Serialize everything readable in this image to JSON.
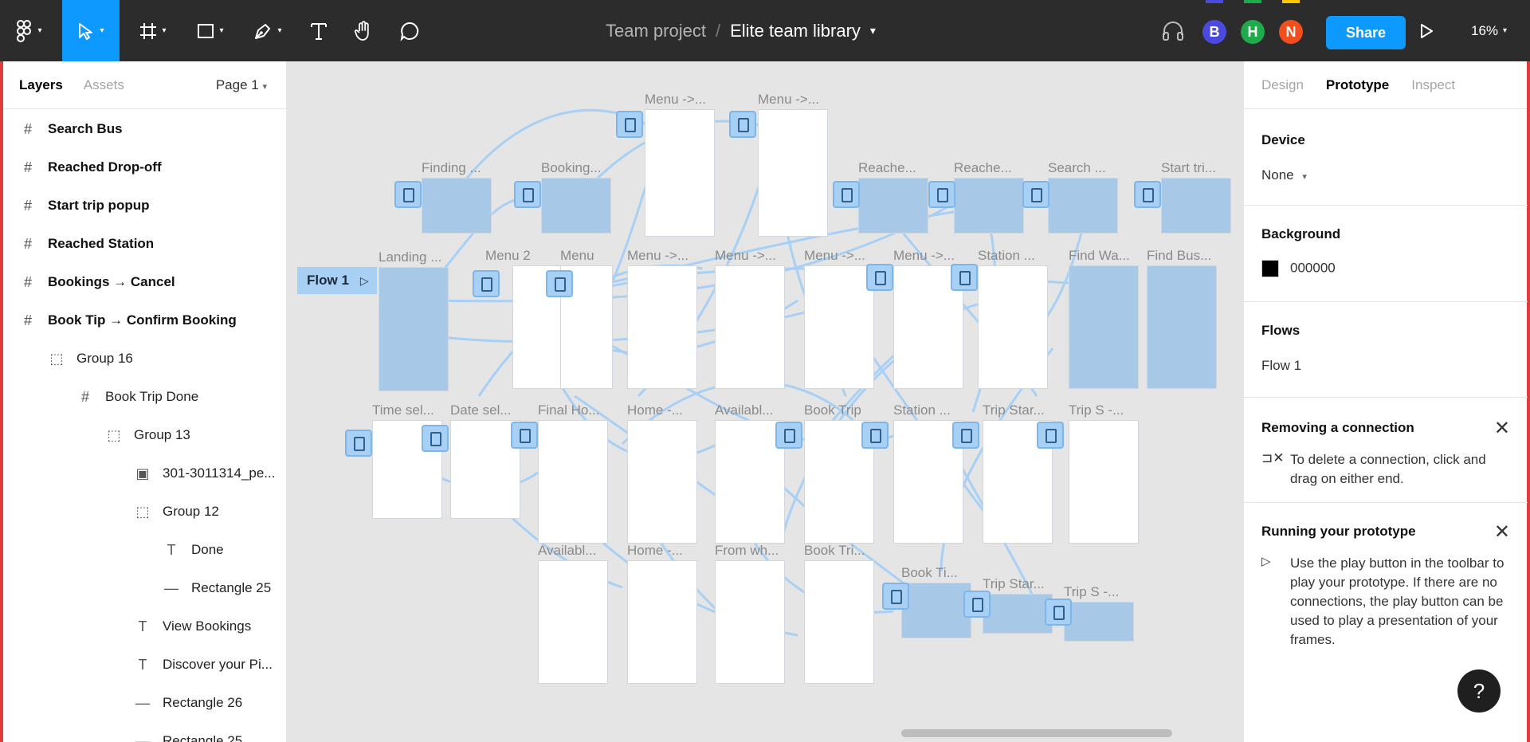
{
  "toolbar": {
    "tools": [
      {
        "name": "main-menu",
        "icon": "figma-logo-icon"
      },
      {
        "name": "move-tool",
        "icon": "pointer-icon",
        "active": true
      },
      {
        "name": "frame-tool",
        "icon": "frame-icon"
      },
      {
        "name": "shape-tool",
        "icon": "rectangle-icon"
      },
      {
        "name": "pen-tool",
        "icon": "pen-icon"
      },
      {
        "name": "text-tool",
        "icon": "text-icon"
      },
      {
        "name": "hand-tool",
        "icon": "hand-icon"
      },
      {
        "name": "comment-tool",
        "icon": "comment-icon"
      }
    ],
    "team": "Team project",
    "separator": "/",
    "file_name": "Elite team library",
    "avatars": [
      {
        "initial": "B",
        "color": "#4a4ae0",
        "bar_color": "#4a4ae0"
      },
      {
        "initial": "H",
        "color": "#1faa4b",
        "bar_color": "#1faa4b"
      },
      {
        "initial": "N",
        "color": "#f24e1e",
        "bar_color": "#ffc700"
      }
    ],
    "share_label": "Share",
    "zoom": "16%"
  },
  "left_panel": {
    "tabs": [
      "Layers",
      "Assets"
    ],
    "page": "Page 1",
    "layers": [
      {
        "type": "frame",
        "label": "Search Bus",
        "indent": 0
      },
      {
        "type": "frame",
        "label": "Reached Drop-off",
        "indent": 0
      },
      {
        "type": "frame",
        "label": "Start trip popup",
        "indent": 0
      },
      {
        "type": "frame",
        "label": "Reached Station",
        "indent": 0
      },
      {
        "type": "frame",
        "label": "Bookings → Cancel",
        "indent": 0
      },
      {
        "type": "frame",
        "label": "Book Tip → Confirm Booking",
        "indent": 0
      },
      {
        "type": "group",
        "label": "Group 16",
        "indent": 1
      },
      {
        "type": "frame-inner",
        "label": "Book Trip Done",
        "indent": 2
      },
      {
        "type": "group",
        "label": "Group 13",
        "indent": 3
      },
      {
        "type": "image",
        "label": "301-3011314_pe...",
        "indent": 4
      },
      {
        "type": "group",
        "label": "Group 12",
        "indent": 4
      },
      {
        "type": "text",
        "label": "Done",
        "indent": 5
      },
      {
        "type": "rect",
        "label": "Rectangle 25",
        "indent": 5
      },
      {
        "type": "text",
        "label": "View Bookings",
        "indent": 4
      },
      {
        "type": "text",
        "label": "Discover your Pi...",
        "indent": 4
      },
      {
        "type": "rect",
        "label": "Rectangle 26",
        "indent": 4
      },
      {
        "type": "rect",
        "label": "Rectangle 25",
        "indent": 4
      }
    ]
  },
  "right_panel": {
    "tabs": [
      "Design",
      "Prototype",
      "Inspect"
    ],
    "device": {
      "heading": "Device",
      "value": "None"
    },
    "background": {
      "heading": "Background",
      "hex": "000000"
    },
    "flows": {
      "heading": "Flows",
      "item": "Flow 1"
    },
    "removing": {
      "heading": "Removing a connection",
      "text": "To delete a connection, click and drag on either end."
    },
    "running": {
      "heading": "Running your prototype",
      "text": "Use the play button in the toolbar to play your prototype. If there are no connections, the play button can be used to play a presentation of your frames."
    },
    "help": "?"
  },
  "canvas": {
    "flow_label": "Flow 1",
    "frames": [
      "Menu ->...",
      "Menu ->...",
      "Finding ...",
      "Booking...",
      "Reache...",
      "Reache...",
      "Search ...",
      "Start tri...",
      "Landing ...",
      "Menu 2",
      "Menu",
      "Menu ->...",
      "Menu ->...",
      "Menu ->...",
      "Menu ->...",
      "Station ...",
      "Find  Wa...",
      "Find Bus...",
      "Time sel...",
      "Date sel...",
      "Final Ho...",
      "Home -...",
      "Availabl...",
      "Book Trip",
      "Station ...",
      "Trip Star...",
      "Trip S -...",
      "Availabl...",
      "Home -...",
      "From wh...",
      "Book Tri...",
      "Book Ti...",
      "Trip Star...",
      "Trip S -..."
    ]
  }
}
